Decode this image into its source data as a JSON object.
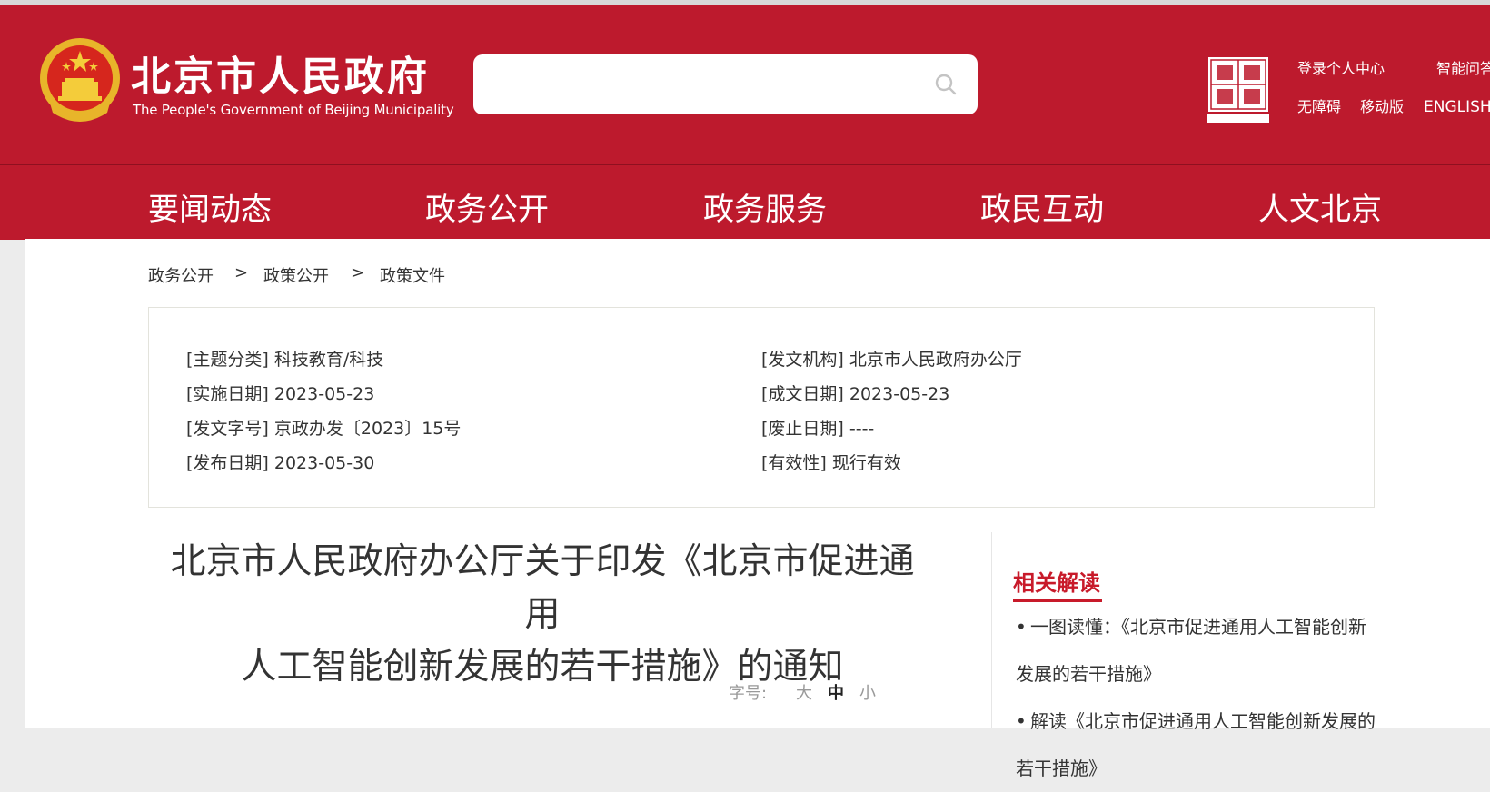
{
  "site": {
    "name_cn": "北京市人民政府",
    "name_en": "The People's Government of Beijing Municipality"
  },
  "search": {
    "placeholder": ""
  },
  "top_links": {
    "login": "登录个人中心",
    "smart_qa": "智能问答",
    "accessible": "无障碍",
    "mobile": "移动版",
    "english": "ENGLISH"
  },
  "nav": [
    "要闻动态",
    "政务公开",
    "政务服务",
    "政民互动",
    "人文北京"
  ],
  "breadcrumb": [
    "政务公开",
    "政策公开",
    "政策文件"
  ],
  "breadcrumb_sep": ">",
  "meta": {
    "topic": "[主题分类] 科技教育/科技",
    "issuer": "[发文机构] 北京市人民政府办公厅",
    "effective_date": "[实施日期] 2023-05-23",
    "written_date": "[成文日期] 2023-05-23",
    "doc_no": "[发文字号] 京政办发〔2023〕15号",
    "repeal_date": "[废止日期] ----",
    "publish_date": "[发布日期] 2023-05-30",
    "validity": "[有效性] 现行有效"
  },
  "article": {
    "title_line1": "北京市人民政府办公厅关于印发《北京市促进通用",
    "title_line2": "人工智能创新发展的若干措施》的通知"
  },
  "font_size": {
    "label": "字号:",
    "large": "大",
    "medium": "中",
    "small": "小"
  },
  "related": {
    "title": "相关解读",
    "items": [
      "一图读懂：《北京市促进通用人工智能创新发展的若干措施》",
      "解读《北京市促进通用人工智能创新发展的若干措施》"
    ]
  },
  "colors": {
    "brand_red": "#bd1a2d",
    "accent_red": "#c81a2a"
  }
}
